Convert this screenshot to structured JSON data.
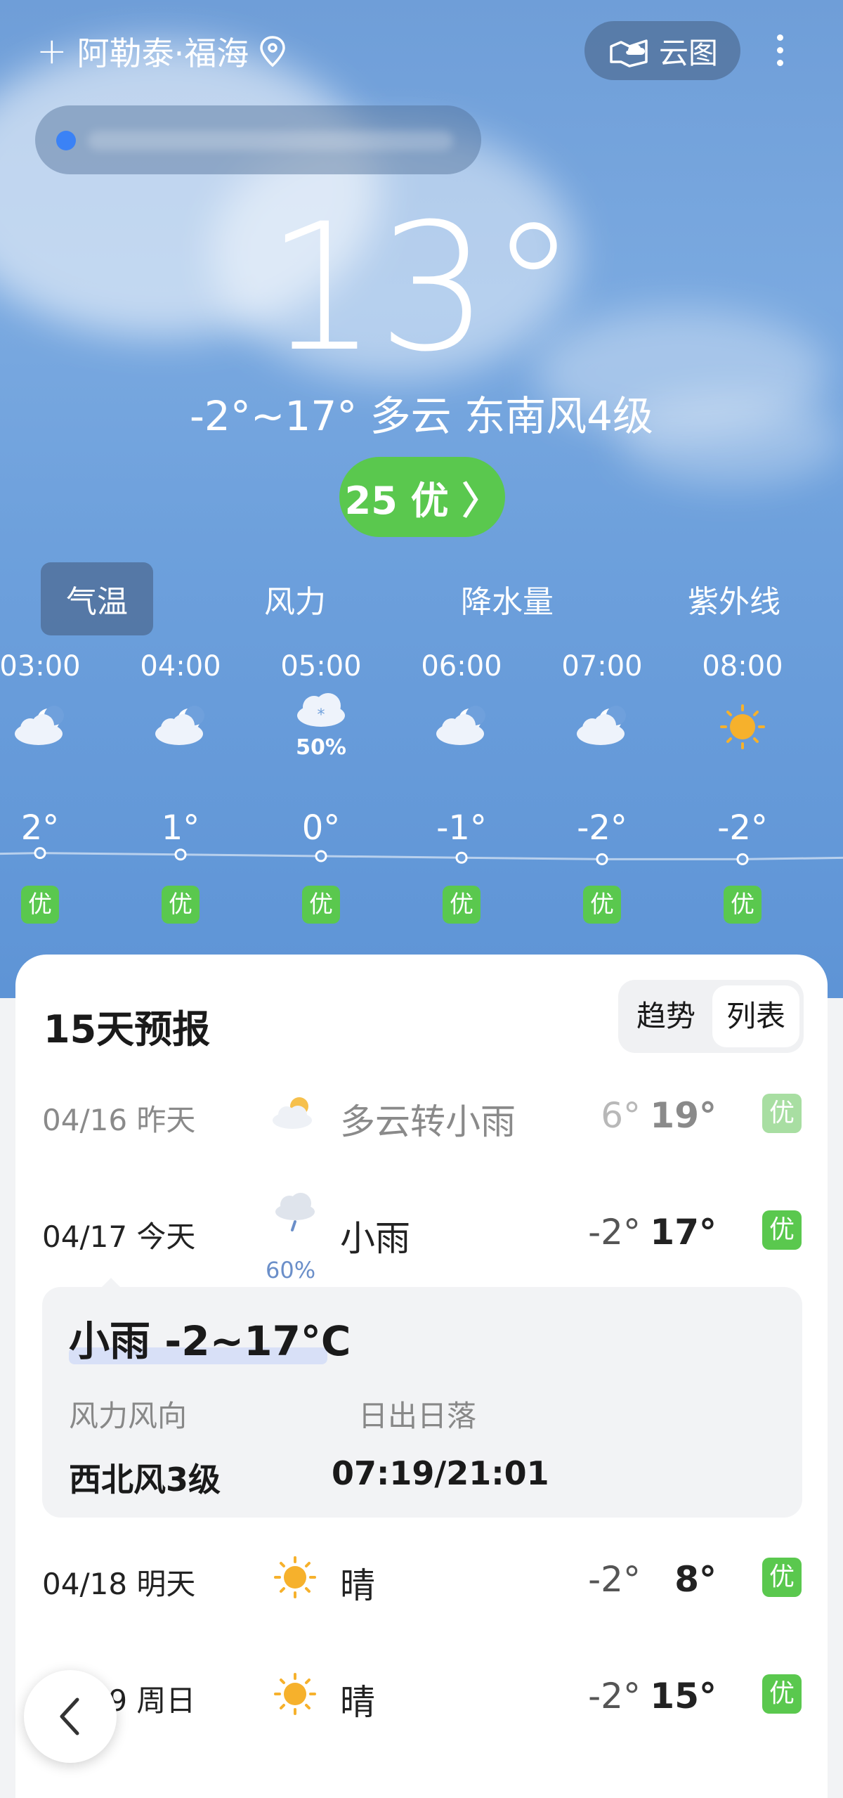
{
  "header": {
    "add_symbol": "+",
    "city": "阿勒泰·福海",
    "location_icon": "location-pin-icon",
    "cloud_map_label": "云图",
    "more_icon": "more-vertical-icon"
  },
  "current": {
    "temperature": "13°",
    "summary": "-2°~17° 多云 东南风4级",
    "aqi_label": "25 优 〉",
    "aqi_color": "#5ac84e"
  },
  "tabs": [
    {
      "label": "气温",
      "active": true
    },
    {
      "label": "风力",
      "active": false
    },
    {
      "label": "降水量",
      "active": false
    },
    {
      "label": "紫外线",
      "active": false
    }
  ],
  "hourly": [
    {
      "time": "03:00",
      "icon": "moon-cloud-icon",
      "temp": "2°",
      "value": 2,
      "aqi": "优"
    },
    {
      "time": "04:00",
      "icon": "moon-cloud-icon",
      "temp": "1°",
      "value": 1,
      "aqi": "优"
    },
    {
      "time": "05:00",
      "icon": "snow-cloud-icon",
      "precip": "50%",
      "temp": "0°",
      "value": 0,
      "aqi": "优"
    },
    {
      "time": "06:00",
      "icon": "moon-cloud-icon",
      "temp": "-1°",
      "value": -1,
      "aqi": "优"
    },
    {
      "time": "07:00",
      "icon": "moon-cloud-icon",
      "temp": "-2°",
      "value": -2,
      "aqi": "优"
    },
    {
      "time": "08:00",
      "icon": "sun-icon",
      "temp": "-2°",
      "value": -2,
      "aqi": "优"
    }
  ],
  "forecast": {
    "title": "15天预报",
    "toggle": [
      "趋势",
      "列表"
    ],
    "rows": [
      {
        "date": "04/16 昨天",
        "icon": "sun-cloud-icon",
        "condition": "多云转小雨",
        "low": "6°",
        "high": "19°",
        "aqi": "优",
        "past": true
      },
      {
        "date": "04/17 今天",
        "icon": "rain-cloud-icon",
        "precip": "60%",
        "condition": "小雨",
        "low": "-2°",
        "high": "17°",
        "aqi": "优",
        "past": false
      },
      {
        "date": "04/18 明天",
        "icon": "sun-icon",
        "condition": "晴",
        "low": "-2°",
        "high": "8°",
        "aqi": "优",
        "past": false
      },
      {
        "date": "04/19 周日",
        "icon": "sun-icon",
        "condition": "晴",
        "low": "-2°",
        "high": "15°",
        "aqi": "优",
        "past": false
      }
    ],
    "detail": {
      "title": "小雨 -2~17°C",
      "wind_label": "风力风向",
      "wind_value": "西北风3级",
      "sun_label": "日出日落",
      "sun_value": "07:19/21:01"
    }
  },
  "nav": {
    "back_icon": "chevron-left-icon"
  }
}
